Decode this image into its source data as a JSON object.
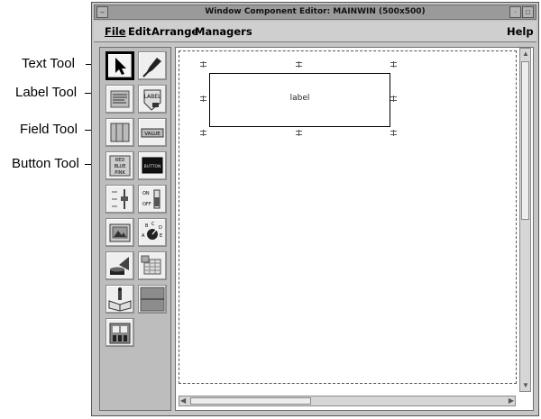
{
  "window": {
    "title": "Window Component Editor: MAINWIN (500x500)",
    "menu": {
      "file": "File",
      "edit": "Edit",
      "arrange": "Arrange",
      "managers": "Managers",
      "help": "Help"
    }
  },
  "callouts": {
    "text_tool": "Text Tool",
    "label_tool": "Label Tool",
    "field_tool": "Field Tool",
    "button_tool": "Button Tool"
  },
  "palette": {
    "label_icon_text": "LABEL",
    "field_icon_text": "VALUE",
    "button_icon_text": "BUTTON",
    "slider_on": "ON",
    "slider_off": "OFF",
    "list_text": [
      "RED",
      "BLUE",
      "PINK"
    ],
    "dial_letters": [
      "A",
      "B",
      "C",
      "D",
      "E"
    ]
  },
  "canvas": {
    "label_component_text": "label"
  }
}
